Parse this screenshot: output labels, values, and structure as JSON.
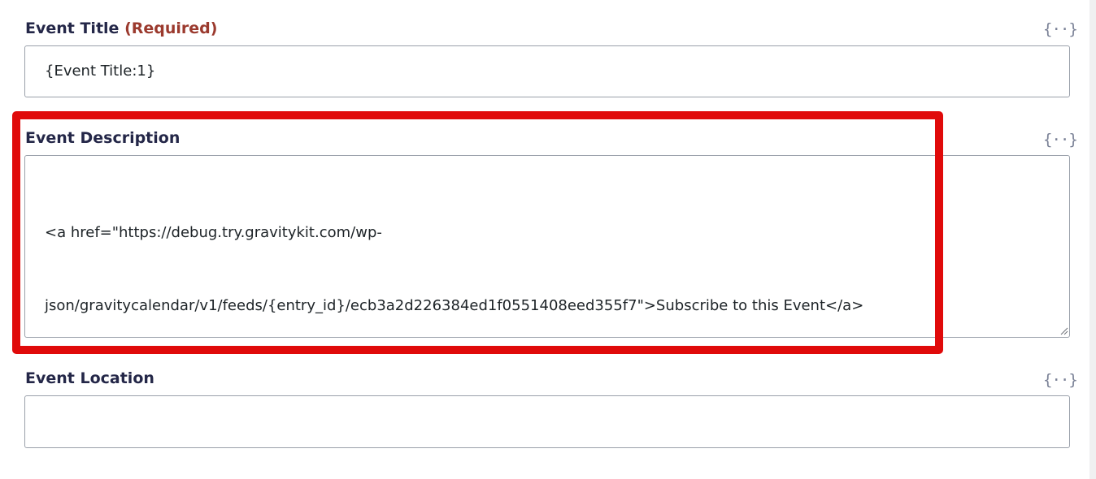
{
  "fields": {
    "title": {
      "label": "Event Title",
      "required": "(Required)",
      "value": "{Event Title:1}"
    },
    "description": {
      "label": "Event Description",
      "value_lines": [
        "<a href=\"https://debug.try.gravitykit.com/wp-",
        "json/gravitycalendar/v1/feeds/{entry_id}/ecb3a2d226384ed1f0551408eed355f7\">Subscribe to this Event</a>"
      ]
    },
    "location": {
      "label": "Event Location",
      "value": ""
    }
  },
  "merge_tag_icon": {
    "glyph": "{··}",
    "icon": "merge-tags-icon"
  },
  "colors": {
    "highlight": "#e00a0a",
    "required": "#9b3a2e",
    "label": "#242748",
    "merge_tag": "#7a8196"
  }
}
